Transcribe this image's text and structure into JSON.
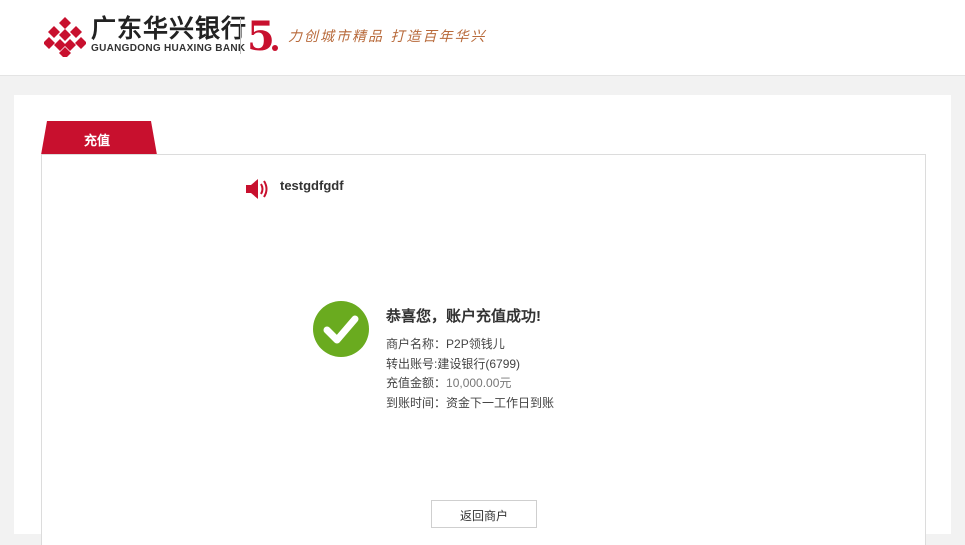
{
  "header": {
    "bank_name_cn": "广东华兴银行",
    "bank_name_en": "GUANGDONG HUAXING BANK",
    "anniversary_number": "5",
    "slogan": "力创城市精品  打造百年华兴",
    "logo_icon": "huaxing-bank-logo",
    "brand_color": "#c8102e",
    "slogan_color": "#b86a3b"
  },
  "tab": {
    "label": "充值"
  },
  "notice": {
    "icon": "speaker-icon",
    "text": "testgdfgdf"
  },
  "result": {
    "icon": "check-circle-icon",
    "icon_color": "#6aab1f",
    "title": "恭喜您，账户充值成功!",
    "merchant_label": "商户名称：",
    "merchant_value": "P2P领钱儿",
    "account_label": "转出账号:",
    "account_value": "建设银行(6799)",
    "amount_label": "充值金额：",
    "amount_value": "10,000.00元",
    "arrival_label": "到账时间：",
    "arrival_value": "资金下一工作日到账"
  },
  "actions": {
    "back_label": "返回商户"
  }
}
